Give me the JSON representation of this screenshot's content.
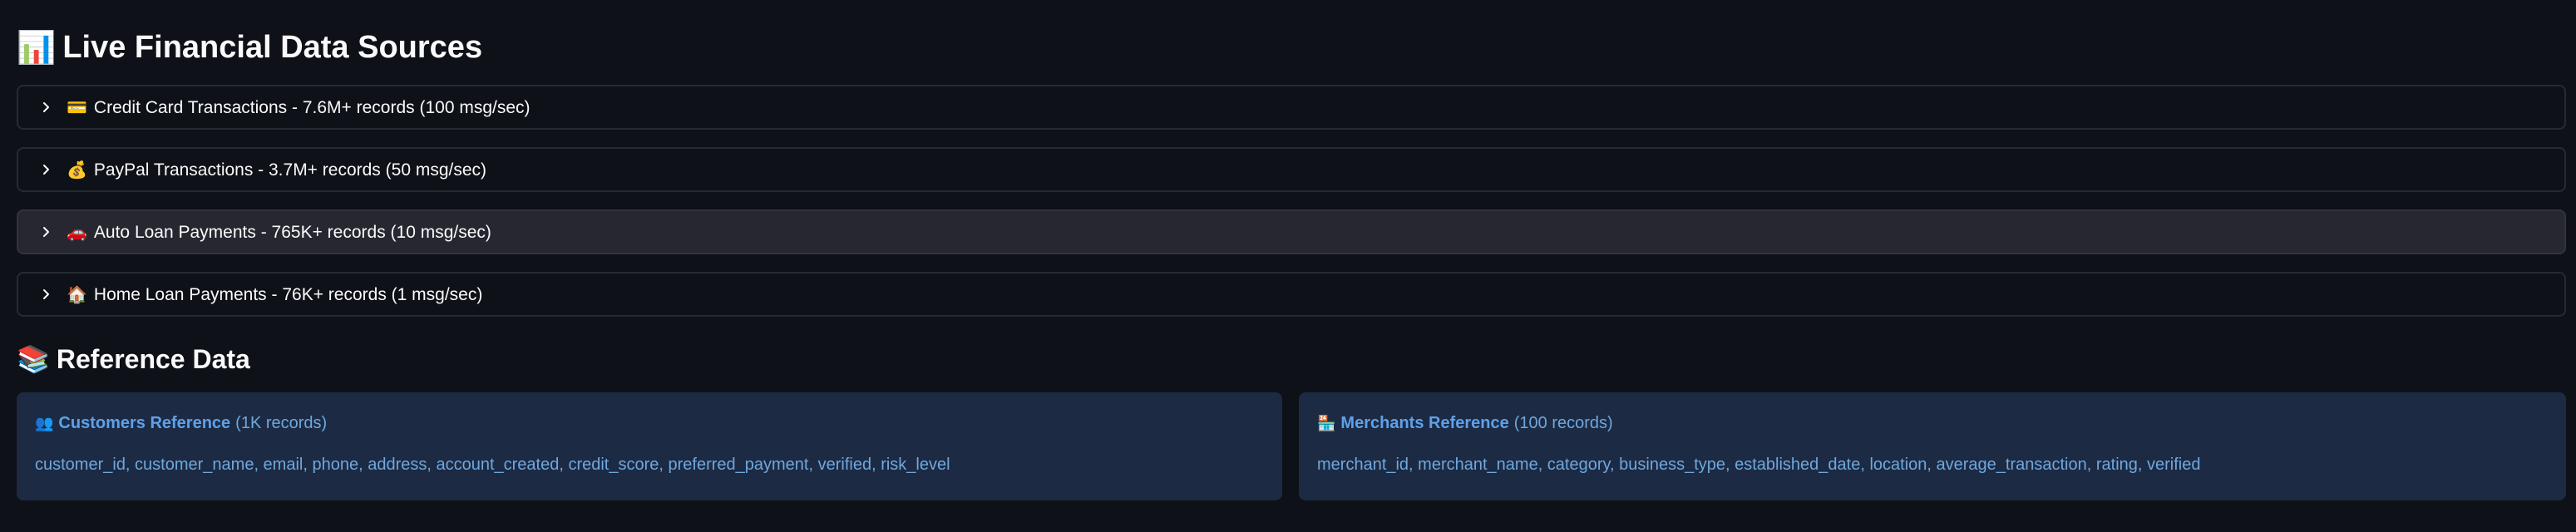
{
  "live_section": {
    "emoji": "📊",
    "title": "Live Financial Data Sources"
  },
  "expanders": [
    {
      "emoji": "💳",
      "label": "Credit Card Transactions - 7.6M+ records (100 msg/sec)"
    },
    {
      "emoji": "💰",
      "label": "PayPal Transactions - 3.7M+ records (50 msg/sec)"
    },
    {
      "emoji": "🚗",
      "label": "Auto Loan Payments - 765K+ records (10 msg/sec)"
    },
    {
      "emoji": "🏠",
      "label": "Home Loan Payments - 76K+ records (1 msg/sec)"
    }
  ],
  "reference_section": {
    "emoji": "📚",
    "title": "Reference Data"
  },
  "reference_cards": [
    {
      "emoji": "👥",
      "name": "Customers Reference",
      "count": "(1K records)",
      "fields": "customer_id, customer_name, email, phone, address, account_created, credit_score, preferred_payment, verified, risk_level"
    },
    {
      "emoji": "🏪",
      "name": "Merchants Reference",
      "count": "(100 records)",
      "fields": "merchant_id, merchant_name, category, business_type, established_date, location, average_transaction, rating, verified"
    }
  ],
  "colors": {
    "background": "#0e1117",
    "card_background": "#1c2a44",
    "card_text": "#6fa8dc",
    "hover_expander": "#262730"
  },
  "icons": {
    "expander_toggle": "chevron-right-icon"
  }
}
